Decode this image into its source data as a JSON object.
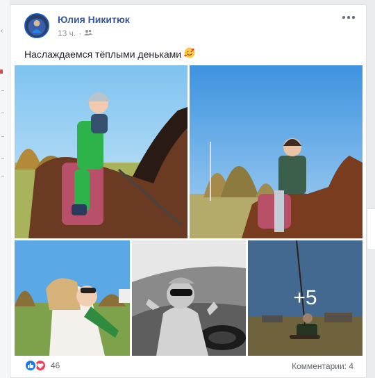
{
  "post": {
    "author": "Юлия Никитюк",
    "time": "13 ч.",
    "separator": "·",
    "audience_icon": "friends-icon",
    "text": "Наслаждаемся тёплыми деньками",
    "emoji": "smiling-face-with-hearts",
    "more_photos_label": "+5"
  },
  "footer": {
    "reaction_count": "46",
    "comments_label": "Комментарии: 4"
  },
  "colors": {
    "author_link": "#385898",
    "like_blue": "#1877f2",
    "love_red": "#f33e58"
  }
}
